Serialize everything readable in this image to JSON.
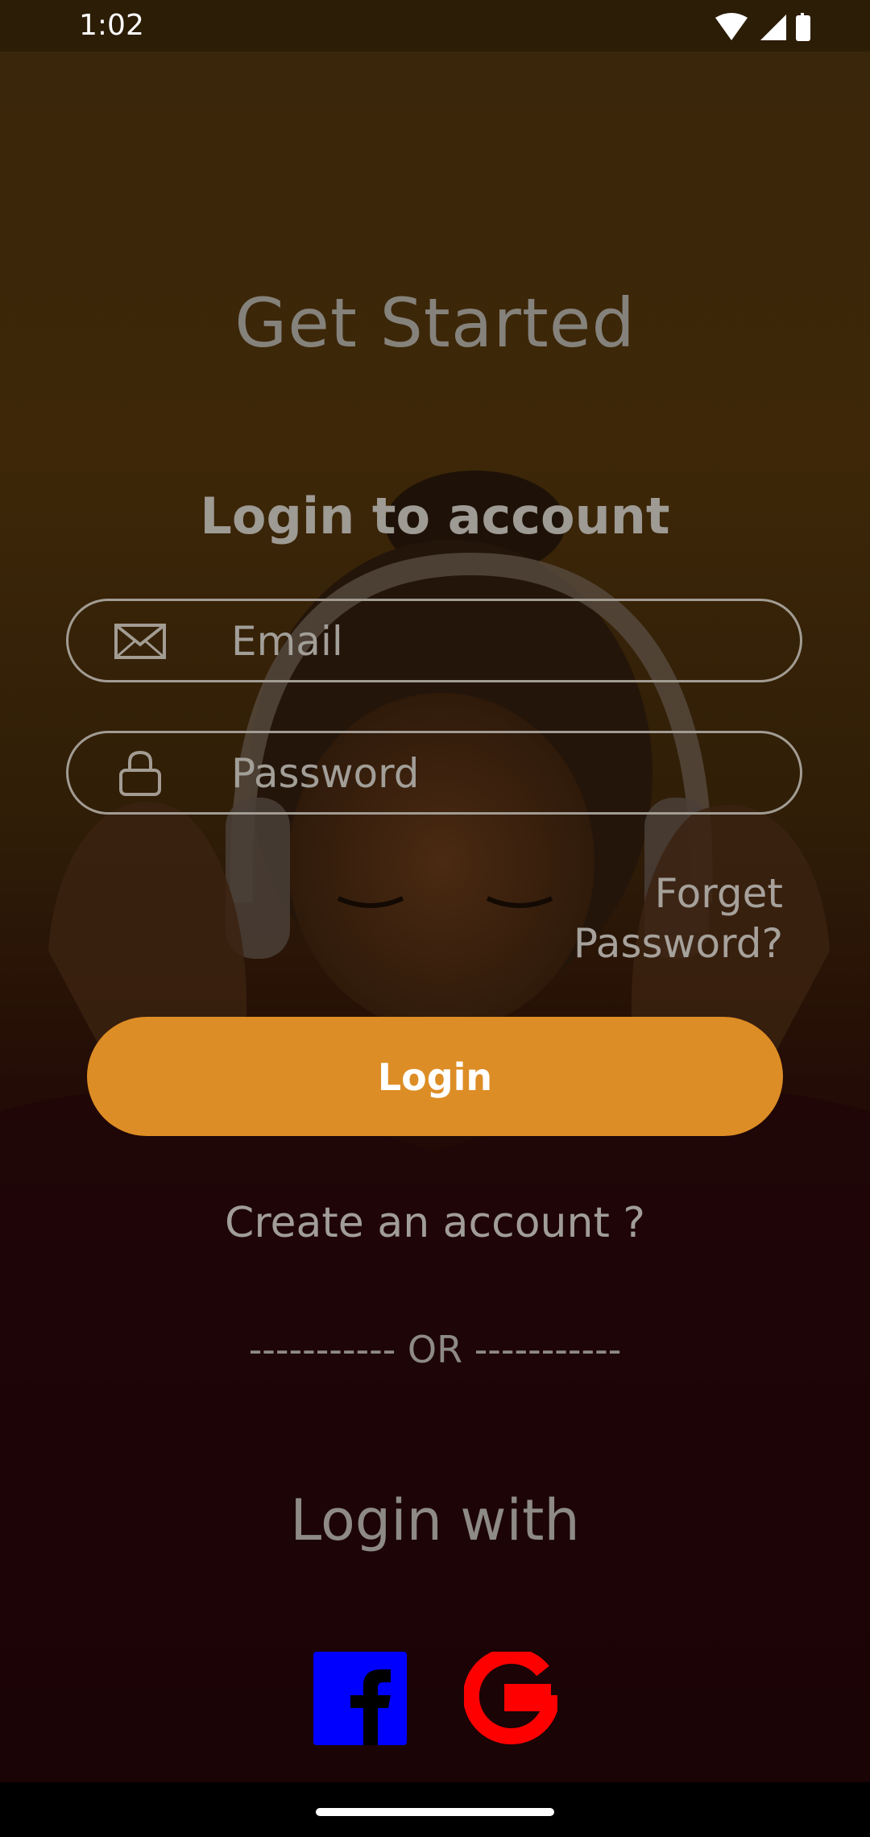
{
  "status_bar": {
    "time": "1:02"
  },
  "header": {
    "title": "Get Started",
    "subtitle": "Login to account"
  },
  "form": {
    "email_placeholder": "Email",
    "password_placeholder": "Password",
    "forget_password": "Forget Password?",
    "login_label": "Login",
    "create_account": "Create an account ?"
  },
  "divider": {
    "or_text": "----------- OR -----------"
  },
  "social": {
    "title": "Login with",
    "providers": [
      {
        "name": "facebook",
        "color": "#0000ff"
      },
      {
        "name": "google",
        "color": "#ff0000"
      }
    ]
  },
  "colors": {
    "accent": "#dd8d25",
    "field_border": "#a29c93"
  },
  "icons": {
    "email": "mail-icon",
    "password": "lock-icon"
  }
}
